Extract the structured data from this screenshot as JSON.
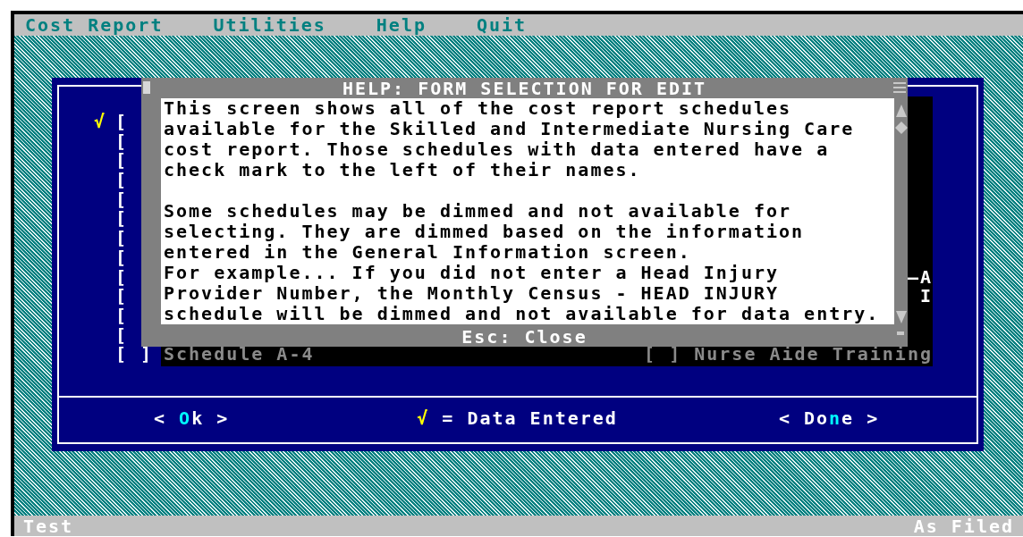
{
  "menu": [
    {
      "label": "Cost Report"
    },
    {
      "label": "Utilities"
    },
    {
      "label": "Help"
    },
    {
      "label": "Quit"
    }
  ],
  "check_glyph": "√",
  "schedules": [
    {
      "bracket": "[",
      "checked": true
    },
    {
      "bracket": "[",
      "checked": false
    },
    {
      "bracket": "[",
      "checked": false
    },
    {
      "bracket": "[",
      "checked": false
    },
    {
      "bracket": "[",
      "checked": false
    },
    {
      "bracket": "[",
      "checked": false
    },
    {
      "bracket": "[",
      "checked": false
    },
    {
      "bracket": "[",
      "checked": false
    },
    {
      "bracket": "[",
      "checked": false,
      "right": "—A"
    },
    {
      "bracket": "[",
      "checked": false,
      "right": "I"
    },
    {
      "bracket": "[",
      "checked": false
    },
    {
      "bracket": "[",
      "checked": false
    },
    {
      "bracket": "[ ]",
      "label": "Schedule A-4",
      "checked": false,
      "dimmed": true,
      "right": "[ ] Nurse Aide Training"
    }
  ],
  "help": {
    "title": "HELP: FORM SELECTION FOR EDIT",
    "paragraphs": [
      [
        "This screen shows all of the cost report schedules",
        "available for the Skilled and Intermediate Nursing Care",
        "cost report. Those schedules with data entered have a",
        "check mark to the left of their names."
      ],
      [
        "Some schedules may be dimmed and not available for",
        "selecting. They are dimmed based on the information",
        "entered in the General Information screen."
      ],
      [
        "For example... If you did not enter a Head Injury",
        "Provider Number, the Monthly Census - HEAD INJURY",
        "schedule will be dimmed and not available for data entry."
      ]
    ],
    "footer": "Esc: Close"
  },
  "buttons": [
    {
      "prefix": "< ",
      "hotkey": "O",
      "suffix": "k >"
    },
    {
      "prefix": "< Do",
      "hotkey": "n",
      "suffix": "e >"
    }
  ],
  "legend": {
    "mark": "√",
    "text": "= Data Entered"
  },
  "status_bar": {
    "left": "Test",
    "right": "As Filed"
  }
}
